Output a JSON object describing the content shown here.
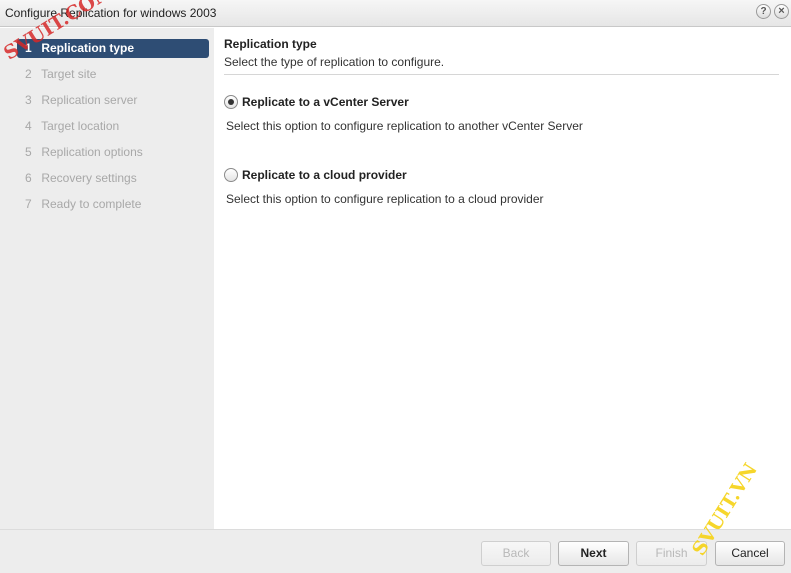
{
  "window": {
    "title": "Configure Replication for windows 2003",
    "help_glyph": "?",
    "close_glyph": "×"
  },
  "steps": [
    {
      "num": "1",
      "label": "Replication type",
      "active": true
    },
    {
      "num": "2",
      "label": "Target site",
      "active": false
    },
    {
      "num": "3",
      "label": "Replication server",
      "active": false
    },
    {
      "num": "4",
      "label": "Target location",
      "active": false
    },
    {
      "num": "5",
      "label": "Replication options",
      "active": false
    },
    {
      "num": "6",
      "label": "Recovery settings",
      "active": false
    },
    {
      "num": "7",
      "label": "Ready to complete",
      "active": false
    }
  ],
  "content": {
    "title": "Replication type",
    "subtitle": "Select the type of replication to configure.",
    "options": [
      {
        "label": "Replicate to a vCenter Server",
        "description": "Select this option to configure replication to another vCenter Server",
        "selected": true
      },
      {
        "label": "Replicate to a cloud provider",
        "description": "Select this option to configure replication to a cloud provider",
        "selected": false
      }
    ]
  },
  "footer": {
    "back": "Back",
    "next": "Next",
    "finish": "Finish",
    "cancel": "Cancel"
  },
  "watermarks": {
    "top_left": "SVUIT.COM",
    "bottom_right": "SVUIT.VN"
  },
  "colors": {
    "active_step": "#2e4d74",
    "sidebar_bg": "#ededed",
    "watermark_red": "#d62828",
    "watermark_yellow": "#f5d214"
  }
}
